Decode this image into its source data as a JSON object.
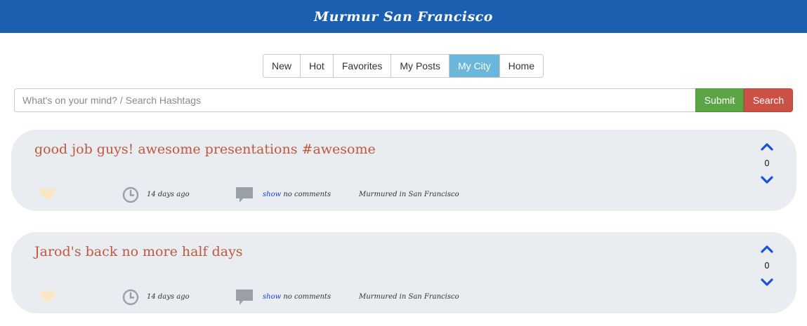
{
  "header": {
    "title": "Murmur San Francisco"
  },
  "tabs": [
    {
      "label": "New",
      "active": false
    },
    {
      "label": "Hot",
      "active": false
    },
    {
      "label": "Favorites",
      "active": false
    },
    {
      "label": "My Posts",
      "active": false
    },
    {
      "label": "My City",
      "active": true
    },
    {
      "label": "Home",
      "active": false
    }
  ],
  "search": {
    "placeholder": "What's on your mind? / Search Hashtags",
    "value": "",
    "submit_label": "Submit",
    "search_label": "Search"
  },
  "posts": [
    {
      "text": "good job guys! awesome presentations #awesome",
      "votes": "0",
      "age": "14 days ago",
      "show_label": "show",
      "comments_label": "no comments",
      "location": "Murmured in San Francisco"
    },
    {
      "text": "Jarod's back no more half days",
      "votes": "0",
      "age": "14 days ago",
      "show_label": "show",
      "comments_label": "no comments",
      "location": "Murmured in San Francisco"
    }
  ],
  "colors": {
    "header_bg": "#1b5fb0",
    "active_tab": "#6ab7db",
    "submit": "#5ca545",
    "search": "#cb5147",
    "post_title": "#c0583a",
    "vote_arrow": "#1a4fe0",
    "heart": "#fbe6c2"
  }
}
